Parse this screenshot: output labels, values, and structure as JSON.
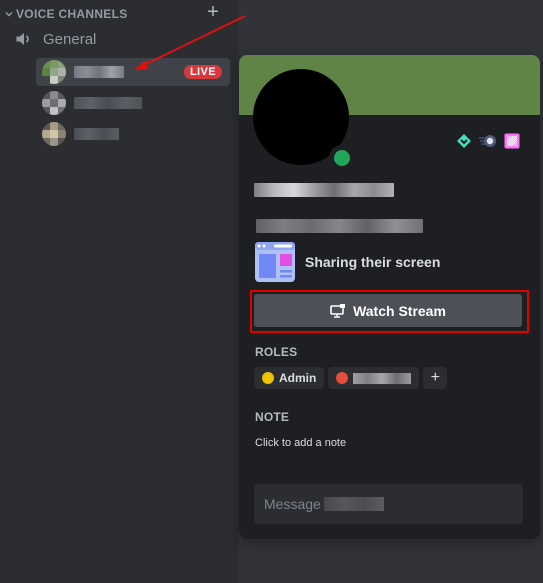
{
  "sidebar": {
    "category": {
      "label": "VOICE CHANNELS",
      "collapsed": false
    },
    "add_channel_icon": "plus-icon",
    "channel": {
      "name": "General",
      "icon": "speaker-icon"
    },
    "voice_users": [
      {
        "name_redacted": true,
        "live": true,
        "live_label": "LIVE",
        "active": true
      },
      {
        "name_redacted": true,
        "live": false,
        "active": false
      },
      {
        "name_redacted": true,
        "live": false,
        "active": false
      }
    ]
  },
  "annotation": {
    "arrow_color": "#e01010",
    "highlight_color": "#e00000"
  },
  "profile": {
    "banner_color": "#5f8445",
    "status": "online",
    "status_color": "#23a55a",
    "badges": [
      "hypesquad-balance-icon",
      "speedster-nitro-icon",
      "nitro-boost-icon"
    ],
    "display_name_redacted": true,
    "username_redacted": true,
    "activity": {
      "text": "Sharing their screen",
      "icon": "screen-share-icon"
    },
    "watch_stream_label": "Watch Stream",
    "roles_title": "ROLES",
    "roles": [
      {
        "name": "Admin",
        "color": "#f0c300"
      },
      {
        "name_redacted": true,
        "color": "#e74c3c"
      }
    ],
    "note_title": "NOTE",
    "note_placeholder": "Click to add a note",
    "message_placeholder": "Message"
  }
}
